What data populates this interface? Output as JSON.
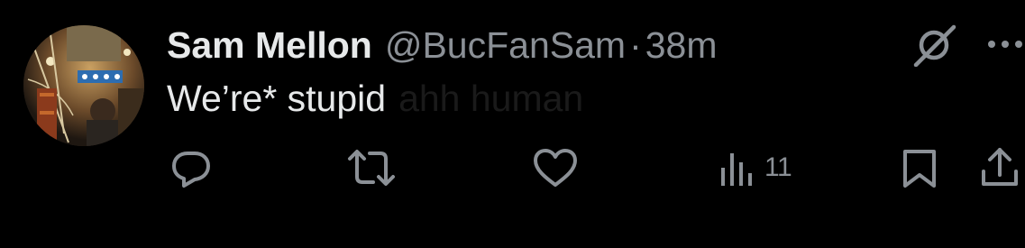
{
  "tweet": {
    "author": {
      "display_name": "Sam Mellon",
      "handle": "@BucFanSam",
      "separator": "·",
      "time": "38m"
    },
    "text": "We’re* stupid",
    "faded_text": "ahh human"
  },
  "header_icons": {
    "grok": "grok-slash-icon",
    "more": "more-dots-icon"
  },
  "actions": {
    "reply": {
      "icon": "reply-bubble-icon"
    },
    "retweet": {
      "icon": "retweet-icon"
    },
    "like": {
      "icon": "heart-icon"
    },
    "views": {
      "icon": "bar-chart-icon",
      "count": "11"
    },
    "bookmark": {
      "icon": "bookmark-icon"
    },
    "share": {
      "icon": "share-icon"
    }
  },
  "colors": {
    "background": "#000000",
    "primary_text": "#e7e9ea",
    "secondary_text": "#8b9096"
  }
}
